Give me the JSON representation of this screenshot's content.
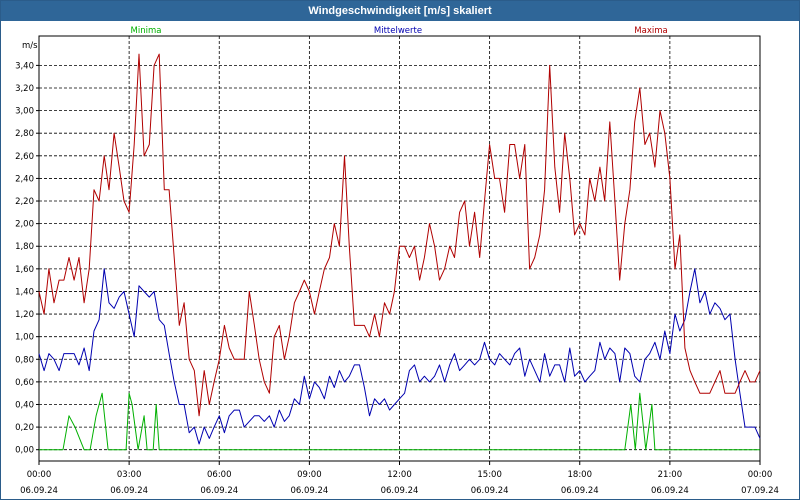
{
  "window": {
    "title": "Windgeschwindigkeit [m/s] skaliert"
  },
  "chart_data": {
    "type": "line",
    "title": "Windgeschwindigkeit [m/s] skaliert",
    "ylabel": "m/s",
    "ylim": [
      -0.1,
      3.66
    ],
    "y_ticks": [
      "0,00",
      "0,20",
      "0,40",
      "0,60",
      "0,80",
      "1,00",
      "1,20",
      "1,40",
      "1,60",
      "1,80",
      "2,00",
      "2,20",
      "2,40",
      "2,60",
      "2,80",
      "3,00",
      "3,20",
      "3,40"
    ],
    "x_range_hours": [
      0,
      24
    ],
    "x_ticks": [
      {
        "time": "00:00",
        "date": "06.09.24"
      },
      {
        "time": "03:00",
        "date": "06.09.24"
      },
      {
        "time": "06:00",
        "date": "06.09.24"
      },
      {
        "time": "09:00",
        "date": "06.09.24"
      },
      {
        "time": "12:00",
        "date": "06.09.24"
      },
      {
        "time": "15:00",
        "date": "06.09.24"
      },
      {
        "time": "18:00",
        "date": "06.09.24"
      },
      {
        "time": "21:00",
        "date": "06.09.24"
      },
      {
        "time": "00:00",
        "date": "07.09.24"
      }
    ],
    "grid": true,
    "legend_position": "top",
    "series": [
      {
        "name": "Minima",
        "color": "#00b000",
        "x_hours": [
          0,
          0.5,
          0.8,
          1.0,
          1.2,
          1.5,
          1.7,
          1.9,
          2.1,
          2.3,
          2.6,
          2.9,
          3.0,
          3.1,
          3.3,
          3.5,
          3.6,
          3.8,
          3.9,
          4.0,
          4.2,
          5,
          6,
          7,
          8,
          9,
          10,
          11,
          12,
          13,
          14,
          15,
          16,
          17,
          18,
          19,
          19.5,
          19.7,
          19.85,
          20.0,
          20.2,
          20.4,
          20.5,
          20.6,
          20.8,
          21,
          22,
          23,
          24
        ],
        "y": [
          0,
          0,
          0,
          0.3,
          0.2,
          0,
          0,
          0.3,
          0.5,
          0,
          0,
          0,
          0.5,
          0.4,
          0,
          0.3,
          0,
          0,
          0.4,
          0,
          0,
          0,
          0,
          0,
          0,
          0,
          0,
          0,
          0,
          0,
          0,
          0,
          0,
          0,
          0,
          0,
          0,
          0.4,
          0,
          0.5,
          0,
          0.4,
          0,
          0,
          0,
          0,
          0,
          0,
          0
        ]
      },
      {
        "name": "Mittelwerte",
        "color": "#0000b0",
        "x_hours": [
          0,
          0.17,
          0.33,
          0.5,
          0.67,
          0.83,
          1.0,
          1.17,
          1.33,
          1.5,
          1.67,
          1.83,
          2.0,
          2.17,
          2.33,
          2.5,
          2.67,
          2.83,
          3.0,
          3.17,
          3.33,
          3.5,
          3.67,
          3.83,
          4.0,
          4.17,
          4.33,
          4.5,
          4.67,
          4.83,
          5.0,
          5.17,
          5.33,
          5.5,
          5.67,
          5.83,
          6.0,
          6.17,
          6.33,
          6.5,
          6.67,
          6.83,
          7.0,
          7.17,
          7.33,
          7.5,
          7.67,
          7.83,
          8.0,
          8.17,
          8.33,
          8.5,
          8.67,
          8.83,
          9.0,
          9.17,
          9.33,
          9.5,
          9.67,
          9.83,
          10.0,
          10.17,
          10.33,
          10.5,
          10.67,
          10.83,
          11.0,
          11.17,
          11.33,
          11.5,
          11.67,
          11.83,
          12.0,
          12.17,
          12.33,
          12.5,
          12.67,
          12.83,
          13.0,
          13.17,
          13.33,
          13.5,
          13.67,
          13.83,
          14.0,
          14.17,
          14.33,
          14.5,
          14.67,
          14.83,
          15.0,
          15.17,
          15.33,
          15.5,
          15.67,
          15.83,
          16.0,
          16.17,
          16.33,
          16.5,
          16.67,
          16.83,
          17.0,
          17.17,
          17.33,
          17.5,
          17.67,
          17.83,
          18.0,
          18.17,
          18.33,
          18.5,
          18.67,
          18.83,
          19.0,
          19.17,
          19.33,
          19.5,
          19.67,
          19.83,
          20.0,
          20.17,
          20.33,
          20.5,
          20.67,
          20.83,
          21.0,
          21.17,
          21.33,
          21.5,
          21.67,
          21.83,
          22.0,
          22.17,
          22.33,
          22.5,
          22.67,
          22.83,
          23.0,
          23.17,
          23.33,
          23.5,
          23.67,
          23.83,
          24.0
        ],
        "y": [
          0.85,
          0.7,
          0.85,
          0.8,
          0.7,
          0.85,
          0.85,
          0.85,
          0.75,
          0.9,
          0.7,
          1.05,
          1.15,
          1.6,
          1.3,
          1.25,
          1.35,
          1.4,
          1.2,
          1.0,
          1.45,
          1.4,
          1.35,
          1.4,
          1.15,
          1.1,
          0.85,
          0.6,
          0.4,
          0.4,
          0.15,
          0.2,
          0.05,
          0.2,
          0.1,
          0.2,
          0.3,
          0.15,
          0.3,
          0.35,
          0.35,
          0.2,
          0.25,
          0.3,
          0.3,
          0.25,
          0.3,
          0.2,
          0.35,
          0.25,
          0.3,
          0.45,
          0.4,
          0.65,
          0.45,
          0.6,
          0.55,
          0.45,
          0.65,
          0.55,
          0.7,
          0.6,
          0.65,
          0.75,
          0.75,
          0.55,
          0.3,
          0.45,
          0.4,
          0.45,
          0.35,
          0.4,
          0.45,
          0.5,
          0.7,
          0.75,
          0.6,
          0.65,
          0.6,
          0.65,
          0.75,
          0.6,
          0.75,
          0.85,
          0.7,
          0.75,
          0.8,
          0.75,
          0.8,
          0.95,
          0.8,
          0.75,
          0.85,
          0.8,
          0.75,
          0.85,
          0.9,
          0.65,
          0.8,
          0.7,
          0.6,
          0.85,
          0.65,
          0.75,
          0.75,
          0.6,
          0.9,
          0.65,
          0.7,
          0.6,
          0.65,
          0.7,
          0.95,
          0.8,
          0.9,
          0.85,
          0.6,
          0.9,
          0.85,
          0.65,
          0.6,
          0.8,
          0.85,
          0.95,
          0.8,
          1.05,
          0.85,
          1.2,
          1.05,
          1.15,
          1.4,
          1.6,
          1.3,
          1.4,
          1.2,
          1.3,
          1.25,
          1.15,
          1.2,
          0.8,
          0.5,
          0.2,
          0.2,
          0.2,
          0.1,
          0.2,
          0.05,
          0.25,
          0.15,
          0.35,
          0.2,
          0.25,
          0.3,
          0.25,
          0.3
        ]
      },
      {
        "name": "Maxima",
        "color": "#b00000",
        "x_hours": [
          0,
          0.17,
          0.33,
          0.5,
          0.67,
          0.83,
          1.0,
          1.17,
          1.33,
          1.5,
          1.67,
          1.83,
          2.0,
          2.17,
          2.33,
          2.5,
          2.67,
          2.83,
          3.0,
          3.17,
          3.33,
          3.5,
          3.67,
          3.83,
          4.0,
          4.17,
          4.33,
          4.5,
          4.67,
          4.83,
          5.0,
          5.17,
          5.33,
          5.5,
          5.67,
          5.83,
          6.0,
          6.17,
          6.33,
          6.5,
          6.67,
          6.83,
          7.0,
          7.17,
          7.33,
          7.5,
          7.67,
          7.83,
          8.0,
          8.17,
          8.33,
          8.5,
          8.67,
          8.83,
          9.0,
          9.17,
          9.33,
          9.5,
          9.67,
          9.83,
          10.0,
          10.17,
          10.33,
          10.5,
          10.67,
          10.83,
          11.0,
          11.17,
          11.33,
          11.5,
          11.67,
          11.83,
          12.0,
          12.17,
          12.33,
          12.5,
          12.67,
          12.83,
          13.0,
          13.17,
          13.33,
          13.5,
          13.67,
          13.83,
          14.0,
          14.17,
          14.33,
          14.5,
          14.67,
          14.83,
          15.0,
          15.17,
          15.33,
          15.5,
          15.67,
          15.83,
          16.0,
          16.17,
          16.33,
          16.5,
          16.67,
          16.83,
          17.0,
          17.17,
          17.33,
          17.5,
          17.67,
          17.83,
          18.0,
          18.17,
          18.33,
          18.5,
          18.67,
          18.83,
          19.0,
          19.17,
          19.33,
          19.5,
          19.67,
          19.83,
          20.0,
          20.17,
          20.33,
          20.5,
          20.67,
          20.83,
          21.0,
          21.17,
          21.33,
          21.5,
          21.67,
          21.83,
          22.0,
          22.17,
          22.33,
          22.5,
          22.67,
          22.83,
          23.0,
          23.17,
          23.33,
          23.5,
          23.67,
          23.83,
          24.0
        ],
        "y": [
          1.4,
          1.2,
          1.6,
          1.3,
          1.5,
          1.5,
          1.7,
          1.5,
          1.7,
          1.3,
          1.6,
          2.3,
          2.2,
          2.6,
          2.3,
          2.8,
          2.5,
          2.2,
          2.1,
          2.7,
          3.5,
          2.6,
          2.7,
          3.4,
          3.5,
          2.3,
          2.3,
          1.7,
          1.1,
          1.3,
          0.8,
          0.7,
          0.3,
          0.7,
          0.4,
          0.6,
          0.8,
          1.1,
          0.9,
          0.8,
          0.8,
          0.8,
          1.4,
          1.1,
          0.8,
          0.6,
          0.5,
          1.0,
          1.1,
          0.8,
          1.0,
          1.3,
          1.4,
          1.5,
          1.4,
          1.2,
          1.4,
          1.6,
          1.7,
          2.0,
          1.8,
          2.6,
          1.8,
          1.1,
          1.1,
          1.1,
          1.0,
          1.2,
          1.0,
          1.3,
          1.2,
          1.4,
          1.8,
          1.8,
          1.7,
          1.8,
          1.5,
          1.7,
          2.0,
          1.8,
          1.5,
          1.6,
          1.8,
          1.7,
          2.1,
          2.2,
          1.8,
          2.1,
          1.7,
          2.2,
          2.7,
          2.4,
          2.4,
          2.1,
          2.7,
          2.7,
          2.4,
          2.7,
          1.6,
          1.7,
          1.9,
          2.3,
          3.4,
          2.5,
          2.1,
          2.8,
          2.4,
          1.9,
          2.0,
          1.9,
          2.4,
          2.2,
          2.5,
          2.2,
          2.9,
          2.2,
          1.5,
          2.0,
          2.3,
          2.9,
          3.2,
          2.7,
          2.8,
          2.5,
          3.0,
          2.8,
          2.4,
          1.6,
          1.9,
          0.9,
          0.7,
          0.6,
          0.5,
          0.5,
          0.5,
          0.6,
          0.7,
          0.5,
          0.5,
          0.5,
          0.6,
          0.7,
          0.6,
          0.6,
          0.7,
          0.8
        ]
      }
    ]
  }
}
